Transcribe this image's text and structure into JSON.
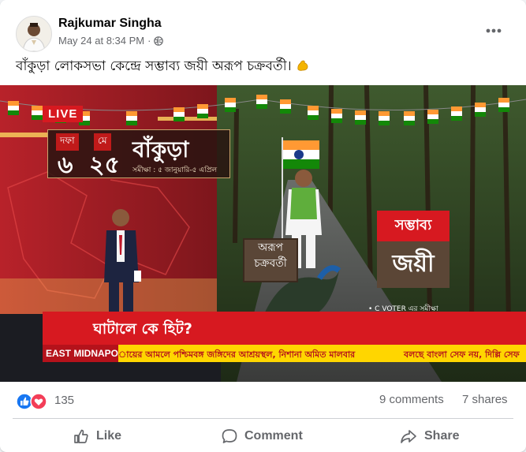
{
  "post": {
    "author": "Rajkumar Singha",
    "time": "May 24 at 8:34 PM",
    "separator": "·",
    "privacy_icon": "globe-icon",
    "more_icon": "more-horizontal-icon",
    "text": "বাঁকুড়া লোকসভা কেন্দ্রে সম্ভাব্য জয়ী অরূপ চক্রবর্তী।",
    "emoji_icon": "flexed-biceps-icon"
  },
  "media": {
    "live_badge": "LIVE",
    "date_labels": [
      "দফা",
      "মে"
    ],
    "date_values": [
      "৬",
      "২৫"
    ],
    "district": "বাঁকুড়া",
    "survey_period": "সমীক্ষা : ৫ জানুয়ারি-৫ এপ্রিল",
    "candidate_name_line1": "অরূপ",
    "candidate_name_line2": "চক্রবর্তী",
    "probable_label": "সম্ভাব্য",
    "winner_label": "জয়ী",
    "source": "• C VOTER এর সমীক্ষা",
    "headline": "ঘাটালে কে হিট?",
    "location": "EAST MIDNAPORE",
    "ticker_1": "ায়ের আমলে পশ্চিমবঙ্গ জঙ্গিদের আশ্রয়স্থল, নিশানা অমিত মালবার",
    "ticker_2": "বলছে বাংলা সেফ নয়, দিল্লি সেফ",
    "colors": {
      "brand_red": "#d71920",
      "ticker_yellow": "#ffd600"
    }
  },
  "stats": {
    "reaction_icons": [
      "like-reaction-icon",
      "love-reaction-icon"
    ],
    "reaction_count": "135",
    "comments": "9 comments",
    "shares": "7 shares"
  },
  "actions": [
    {
      "label": "Like",
      "icon": "thumbs-up-icon"
    },
    {
      "label": "Comment",
      "icon": "comment-bubble-icon"
    },
    {
      "label": "Share",
      "icon": "share-arrow-icon"
    }
  ]
}
